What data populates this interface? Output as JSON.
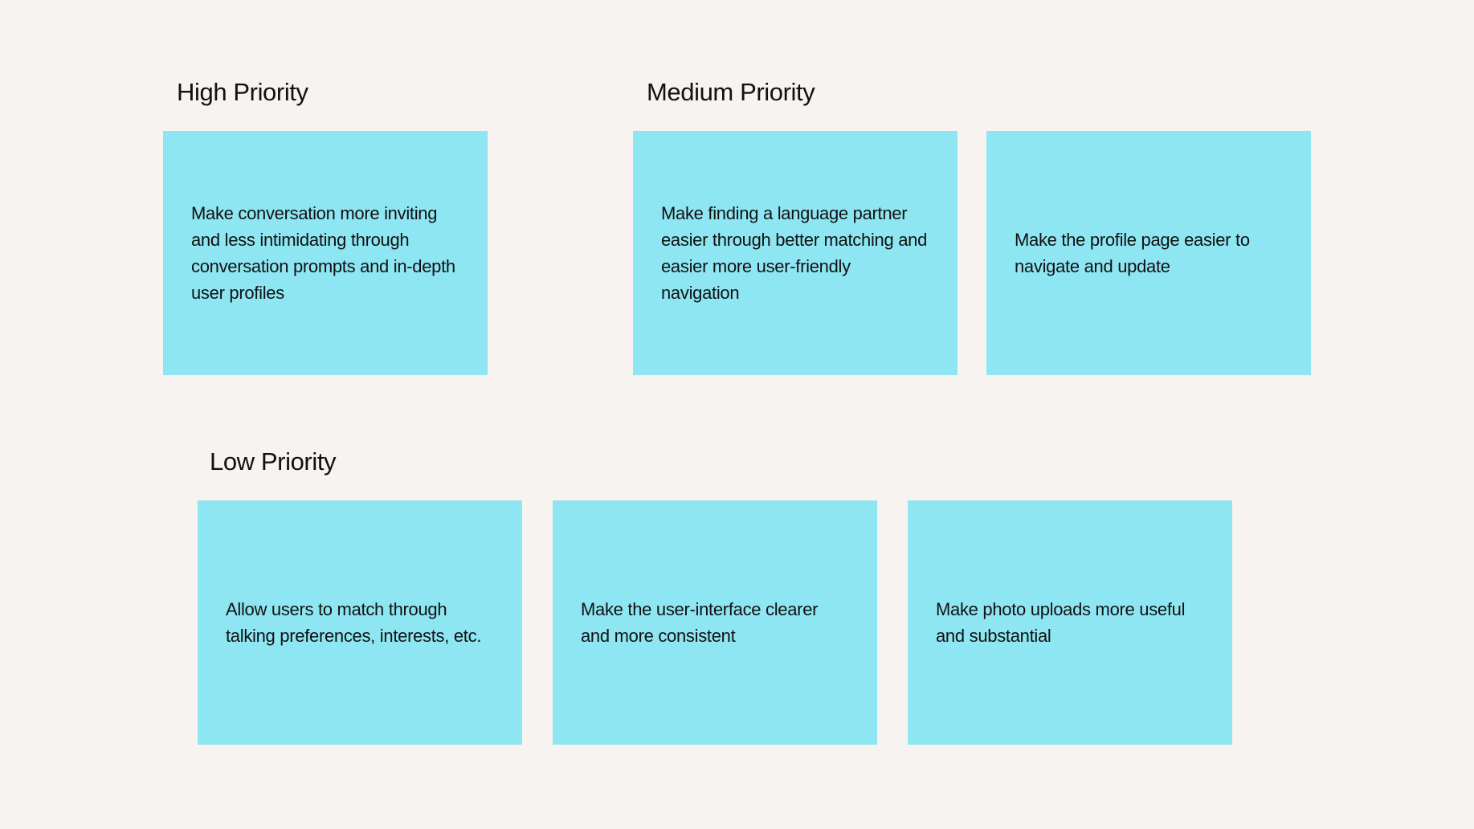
{
  "sections": {
    "high": {
      "title": "High Priority",
      "notes": [
        "Make conversation more inviting and less intimidating through conversation prompts and in-depth user profiles"
      ]
    },
    "medium": {
      "title": "Medium Priority",
      "notes": [
        "Make finding a language partner easier through better matching and easier more user-friendly navigation",
        "Make the profile page easier to navigate and update"
      ]
    },
    "low": {
      "title": "Low Priority",
      "notes": [
        "Allow users to match through talking preferences, interests, etc.",
        "Make the user-interface clearer and more consistent",
        "Make photo uploads more useful and substantial"
      ]
    }
  },
  "colors": {
    "background": "#f6f3f0",
    "sticky_note": "#8ee6f3",
    "text": "#111111"
  }
}
